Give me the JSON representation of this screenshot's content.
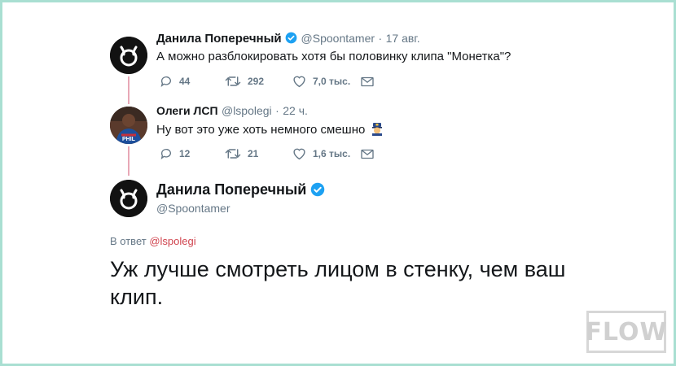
{
  "tweet1": {
    "name": "Данила Поперечный",
    "handle": "@Spoontamer",
    "separator": "·",
    "time": "17 авг.",
    "text": "А можно разблокировать хотя бы половинку клипа \"Монетка\"?",
    "replies": "44",
    "retweets": "292",
    "likes": "7,0 тыс."
  },
  "tweet2": {
    "name": "Олеги ЛСП",
    "handle": "@lspolegi",
    "separator": "·",
    "time": "22 ч.",
    "text": "Ну вот это уже хоть немного смешно",
    "replies": "12",
    "retweets": "21",
    "likes": "1,6 тыс."
  },
  "main_tweet": {
    "name": "Данила Поперечный",
    "handle": "@Spoontamer",
    "reply_prefix": "В ответ",
    "reply_mention": "@lspolegi",
    "text": "Уж лучше смотреть лицом в стенку, чем ваш клип."
  },
  "watermark": {
    "text": "FLOW"
  },
  "colors": {
    "verified": "#1da1f2",
    "thread_line": "#e8a8b6",
    "mention": "#d0454f",
    "frame": "#a9dfd2"
  }
}
